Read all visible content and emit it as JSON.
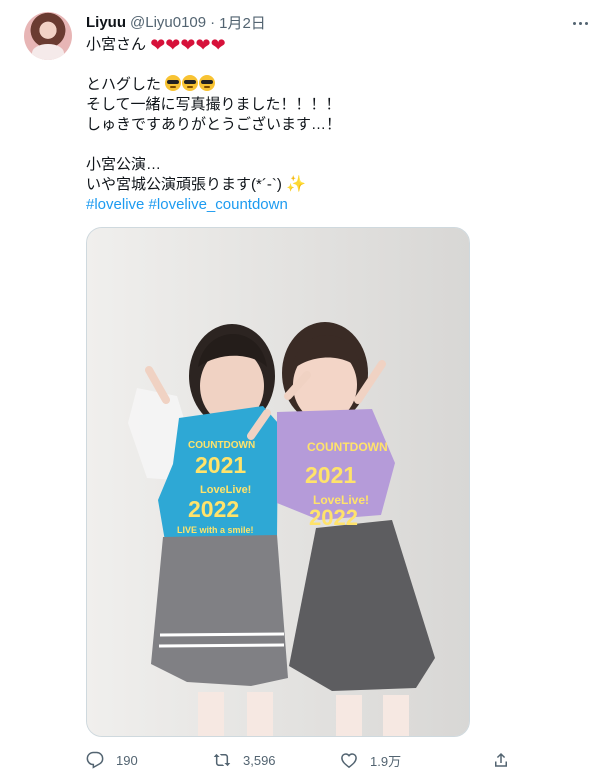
{
  "user": {
    "name": "Liyuu",
    "handle": "@Liyu0109",
    "date": "1月2日"
  },
  "tweet": {
    "line1": "小宮さん",
    "line2": "とハグした",
    "line3": "そして一緒に写真撮りました！！！！",
    "line4": "しゅきですありがとうございます…！",
    "line5": "小宮公演…",
    "line6": "いや宮城公演頑張ります(*´-`)",
    "hashtags": [
      "#lovelive",
      "#lovelive_countdown"
    ]
  },
  "media": {
    "shirt_texts": [
      "COUNTDOWN",
      "2021",
      "LoveLive!",
      "2022",
      "LIVE with a smile!",
      "COUNTDOWN",
      "2021",
      "LoveLive!",
      "2022"
    ]
  },
  "actions": {
    "reply_count": "190",
    "retweet_count": "3,596",
    "like_count": "1.9万"
  },
  "colors": {
    "link": "#1d9bf0",
    "secondary_text": "#536471",
    "heart": "#d6113a"
  },
  "icons": [
    "more-icon",
    "reply-icon",
    "retweet-icon",
    "like-icon",
    "share-icon"
  ]
}
